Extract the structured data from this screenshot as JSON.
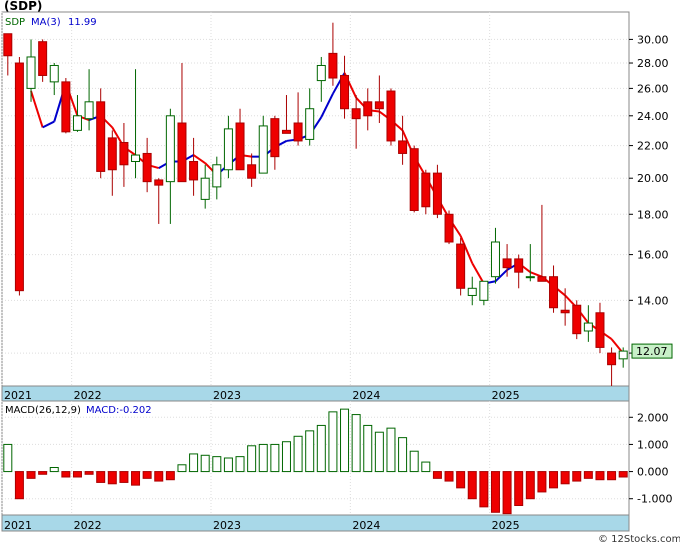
{
  "header": {
    "title": "(SDP)"
  },
  "colors": {
    "up_body": "#ffffff",
    "up_edge": "#006600",
    "down_body": "#ee0000",
    "down_edge": "#aa0000",
    "ma_up": "#0000cc",
    "ma_down": "#ee0000",
    "axis_band": "#a8d8e8",
    "macd_bar": "#006600",
    "macd_neg": "#ee0000",
    "last_price_box": "#c8f0c8"
  },
  "chart_data": [
    {
      "type": "candlestick",
      "name": "price-chart",
      "legend": {
        "symbol": "SDP",
        "ma_label": "MA(3)",
        "ma_value": "11.99"
      },
      "last_price_label": "12.07",
      "y_scale": "log",
      "ylim": [
        10.9,
        32.5
      ],
      "y_ticks": [
        "30.00",
        "28.00",
        "26.00",
        "24.00",
        "22.00",
        "20.00",
        "18.00",
        "16.00",
        "14.00",
        "12.00"
      ],
      "y_tick_values": [
        30,
        28,
        26,
        24,
        22,
        20,
        18,
        16,
        14,
        12
      ],
      "x_labels": [
        {
          "label": "2021",
          "index": 0
        },
        {
          "label": "2022",
          "index": 6
        },
        {
          "label": "2023",
          "index": 18
        },
        {
          "label": "2024",
          "index": 30
        },
        {
          "label": "2025",
          "index": 42
        }
      ],
      "grid": true,
      "ohlc": [
        [
          30.5,
          30.5,
          27.0,
          28.6
        ],
        [
          28.0,
          28.5,
          14.2,
          14.4
        ],
        [
          26.0,
          30.0,
          25.0,
          28.5
        ],
        [
          29.8,
          30.0,
          26.5,
          27.0
        ],
        [
          26.5,
          28.0,
          25.5,
          27.8
        ],
        [
          26.5,
          26.8,
          22.8,
          22.9
        ],
        [
          23.0,
          25.5,
          22.9,
          24.0
        ],
        [
          23.8,
          27.5,
          23.0,
          25.0
        ],
        [
          25.0,
          26.0,
          20.0,
          20.4
        ],
        [
          22.5,
          23.0,
          19.0,
          20.5
        ],
        [
          22.2,
          23.5,
          19.5,
          20.8
        ],
        [
          21.0,
          27.5,
          20.0,
          21.4
        ],
        [
          21.5,
          22.5,
          19.2,
          19.8
        ],
        [
          19.9,
          20.0,
          17.5,
          19.6
        ],
        [
          19.8,
          24.5,
          17.5,
          24.0
        ],
        [
          23.5,
          28.0,
          21.0,
          19.8
        ],
        [
          21.0,
          22.5,
          19.0,
          19.9
        ],
        [
          18.8,
          20.8,
          18.3,
          20.0
        ],
        [
          19.5,
          21.3,
          18.8,
          20.8
        ],
        [
          20.5,
          24.0,
          20.0,
          23.1
        ],
        [
          23.5,
          24.5,
          20.5,
          20.5
        ],
        [
          20.8,
          21.5,
          19.5,
          20.0
        ],
        [
          20.3,
          24.0,
          20.3,
          23.3
        ],
        [
          23.8,
          24.0,
          20.5,
          21.3
        ],
        [
          23.0,
          25.5,
          22.8,
          22.8
        ],
        [
          23.5,
          25.7,
          22.0,
          22.3
        ],
        [
          22.4,
          26.0,
          22.0,
          24.5
        ],
        [
          26.6,
          28.5,
          25.0,
          27.8
        ],
        [
          28.8,
          31.5,
          26.2,
          26.8
        ],
        [
          27.0,
          28.6,
          23.8,
          24.5
        ],
        [
          24.5,
          25.5,
          21.8,
          23.8
        ],
        [
          25.0,
          26.0,
          23.0,
          24.0
        ],
        [
          25.0,
          27.0,
          23.5,
          24.5
        ],
        [
          25.8,
          26.0,
          22.0,
          22.3
        ],
        [
          22.3,
          24.0,
          20.8,
          21.5
        ],
        [
          21.8,
          22.0,
          18.1,
          18.2
        ],
        [
          20.3,
          20.5,
          18.0,
          18.4
        ],
        [
          20.3,
          20.8,
          17.8,
          18.0
        ],
        [
          18.0,
          18.2,
          16.5,
          16.6
        ],
        [
          16.5,
          16.8,
          14.2,
          14.5
        ],
        [
          14.2,
          15.0,
          13.8,
          14.5
        ],
        [
          14.0,
          14.8,
          13.8,
          14.8
        ],
        [
          15.0,
          17.3,
          14.7,
          16.6
        ],
        [
          15.8,
          16.5,
          15.0,
          15.4
        ],
        [
          15.8,
          16.0,
          14.5,
          15.2
        ],
        [
          15.0,
          16.5,
          14.8,
          15.0
        ],
        [
          15.0,
          18.5,
          14.8,
          14.8
        ],
        [
          15.0,
          15.5,
          13.5,
          13.7
        ],
        [
          13.6,
          14.5,
          13.0,
          13.5
        ],
        [
          13.8,
          14.0,
          12.5,
          12.7
        ],
        [
          12.8,
          13.8,
          12.4,
          13.1
        ],
        [
          13.5,
          13.9,
          12.0,
          12.2
        ],
        [
          12.0,
          12.2,
          10.9,
          11.6
        ],
        [
          11.8,
          12.2,
          11.5,
          12.07
        ]
      ],
      "ma_values": [
        null,
        null,
        25.8,
        23.2,
        23.6,
        26.4,
        24.0,
        23.7,
        24.0,
        23.2,
        21.9,
        21.4,
        20.8,
        20.6,
        21.0,
        21.0,
        21.4,
        20.9,
        20.2,
        20.8,
        21.4,
        21.3,
        21.3,
        21.9,
        22.3,
        22.4,
        22.7,
        23.9,
        25.6,
        27.2,
        25.3,
        24.4,
        24.3,
        23.7,
        23.0,
        21.3,
        20.1,
        18.9,
        17.8,
        16.9,
        15.6,
        14.7,
        14.8,
        15.3,
        15.6,
        15.2,
        15.0,
        14.6,
        14.2,
        13.7,
        13.1,
        12.8,
        12.5,
        11.99
      ]
    },
    {
      "type": "bar",
      "name": "macd-histogram",
      "legend": {
        "label": "MACD(26,12,9)",
        "value_label": "MACD:-0.202"
      },
      "ylim": [
        -1.6,
        2.6
      ],
      "y_ticks": [
        "2.000",
        "1.000",
        "0.000",
        "-1.000"
      ],
      "y_tick_values": [
        2,
        1,
        0,
        -1
      ],
      "x_labels": [
        {
          "label": "2021",
          "index": 0
        },
        {
          "label": "2022",
          "index": 6
        },
        {
          "label": "2023",
          "index": 18
        },
        {
          "label": "2024",
          "index": 30
        },
        {
          "label": "2025",
          "index": 42
        }
      ],
      "grid": true,
      "values": [
        1.0,
        -1.0,
        -0.25,
        -0.1,
        0.15,
        -0.2,
        -0.2,
        -0.1,
        -0.4,
        -0.45,
        -0.4,
        -0.5,
        -0.25,
        -0.35,
        -0.3,
        0.25,
        0.65,
        0.6,
        0.55,
        0.5,
        0.55,
        0.95,
        1.0,
        1.0,
        1.1,
        1.3,
        1.5,
        1.7,
        2.2,
        2.3,
        2.1,
        1.7,
        1.45,
        1.6,
        1.25,
        0.75,
        0.35,
        -0.25,
        -0.35,
        -0.6,
        -1.0,
        -1.3,
        -1.5,
        -1.55,
        -1.25,
        -1.0,
        -0.75,
        -0.6,
        -0.45,
        -0.35,
        -0.25,
        -0.3,
        -0.3,
        -0.2
      ]
    }
  ],
  "footer": {
    "watermark": "© 12Stocks.com"
  }
}
